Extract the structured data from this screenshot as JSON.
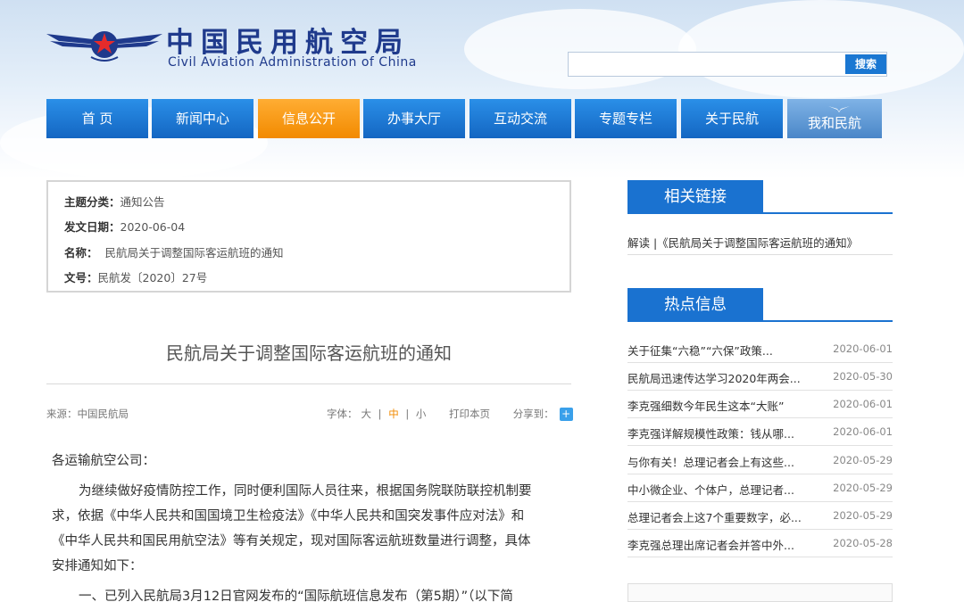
{
  "header": {
    "site_name_cn": "中国民用航空局",
    "site_name_en": "Civil Aviation Administration of China",
    "search_button": "搜索",
    "search_placeholder": ""
  },
  "nav": {
    "items": [
      {
        "label": "首 页"
      },
      {
        "label": "新闻中心"
      },
      {
        "label": "信息公开",
        "active": true
      },
      {
        "label": "办事大厅"
      },
      {
        "label": "互动交流"
      },
      {
        "label": "专题专栏"
      },
      {
        "label": "关于民航"
      },
      {
        "label": "我和民航"
      }
    ]
  },
  "info": {
    "category_label": "主题分类：",
    "category_value": "通知公告",
    "date_label": "发文日期：",
    "date_value": "2020-06-04",
    "name_label": "名称：",
    "name_value": "民航局关于调整国际客运航班的通知",
    "docno_label": "文号：",
    "docno_value": "民航发〔2020〕27号"
  },
  "article": {
    "title": "民航局关于调整国际客运航班的通知",
    "source": "来源：中国民航局",
    "font_label": "字体：",
    "font_large": "大",
    "font_medium": "中",
    "font_small": "小",
    "print": "打印本页",
    "share": "分享到：",
    "greeting": "各运输航空公司：",
    "para1_line1": "为继续做好疫情防控工作，同时便利国际人员往来，根据国务院联防联控机制要",
    "para1_line2": "求，依据《中华人民共和国国境卫生检疫法》《中华人民共和国突发事件应对法》和",
    "para1_line3": "《中华人民共和国民用航空法》等有关规定，现对国际客运航班数量进行调整，具体",
    "para1_line4": "安排通知如下：",
    "para2_line1": "一、已列入民航局3月12日官网发布的“国际航班信息发布（第5期）”（以下简"
  },
  "sidebar": {
    "related_title": "相关链接",
    "related_link": "解读 |《民航局关于调整国际客运航班的通知》",
    "hot_title": "热点信息",
    "hot_items": [
      {
        "title": "关于征集“六稳”“六保”政策...",
        "date": "2020-06-01"
      },
      {
        "title": "民航局迅速传达学习2020年两会...",
        "date": "2020-05-30"
      },
      {
        "title": "李克强细数今年民生这本“大账”",
        "date": "2020-06-01"
      },
      {
        "title": "李克强详解规模性政策：钱从哪...",
        "date": "2020-06-01"
      },
      {
        "title": "与你有关！总理记者会上有这些...",
        "date": "2020-05-29"
      },
      {
        "title": "中小微企业、个体户，总理记者...",
        "date": "2020-05-29"
      },
      {
        "title": "总理记者会上这7个重要数字，必...",
        "date": "2020-05-29"
      },
      {
        "title": "李克强总理出席记者会并答中外...",
        "date": "2020-05-28"
      }
    ]
  },
  "colors": {
    "nav_blue": "#1a72d0",
    "nav_active_orange": "#f28a00",
    "logo_navy": "#1f3a8c"
  }
}
